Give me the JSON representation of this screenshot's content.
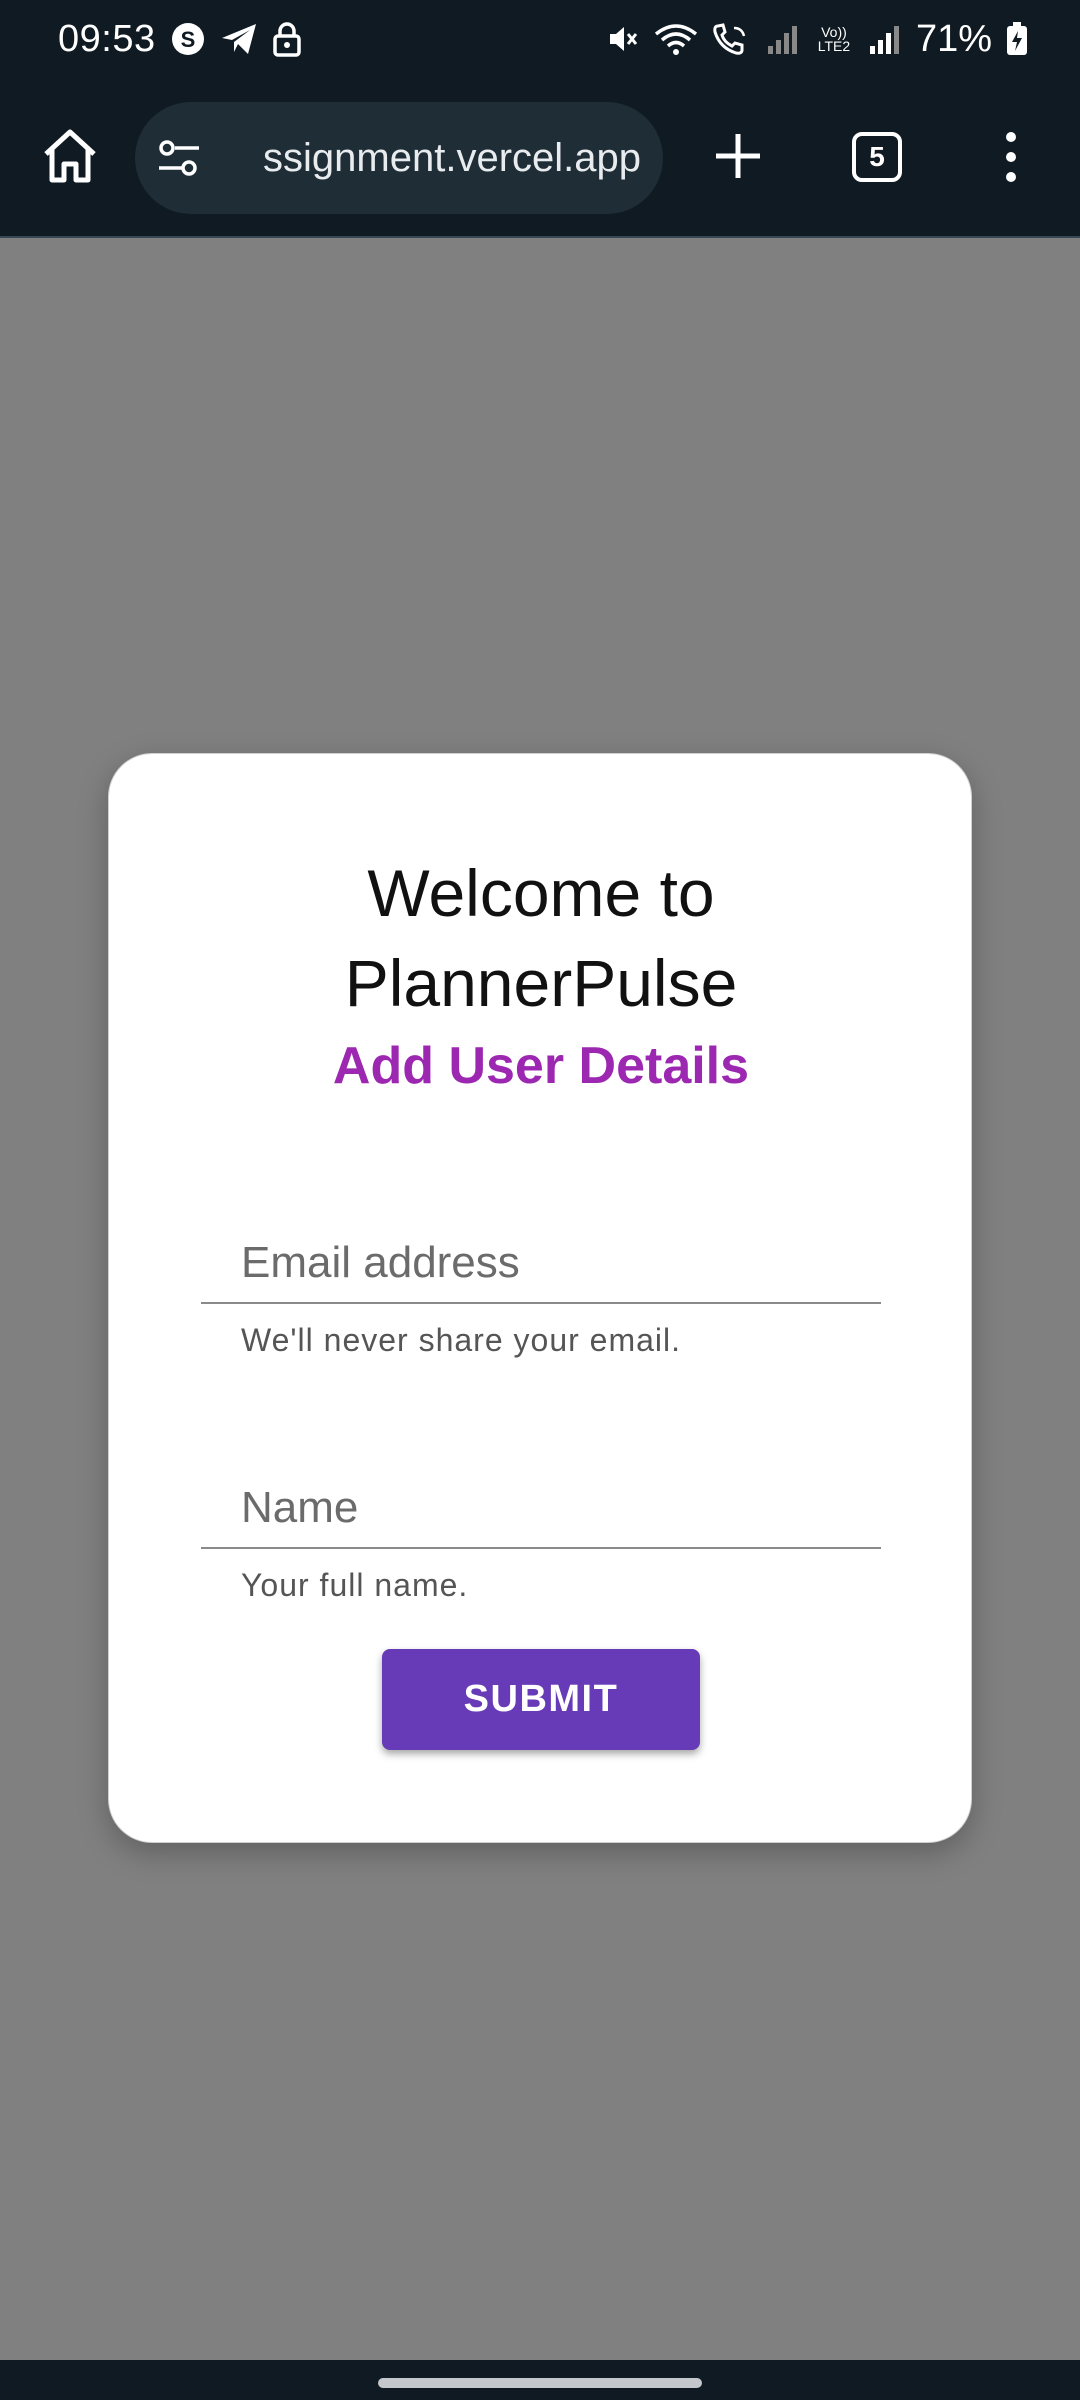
{
  "status_bar": {
    "time": "09:53",
    "battery": "71%",
    "left_icons": [
      "s-app-icon",
      "telegram-icon",
      "lock-icon"
    ],
    "right_icons": [
      "mute-icon",
      "wifi-icon",
      "wifi-call-icon",
      "signal-icon",
      "volte-icon",
      "signal-icon",
      "battery-charging-icon"
    ],
    "network_label": "Vo)) LTE2"
  },
  "browser": {
    "url": "ssignment.vercel.app",
    "tab_count": "5"
  },
  "card": {
    "title": "Welcome to PlannerPulse",
    "subtitle": "Add User Details",
    "email": {
      "placeholder": "Email address",
      "value": "",
      "helper": "We'll never share your email."
    },
    "name": {
      "placeholder": "Name",
      "value": "",
      "helper": "Your full name."
    },
    "submit_label": "SUBMIT"
  },
  "colors": {
    "subtitle": "#9c27b0",
    "submit_button": "#673ab7",
    "backdrop": "#808080",
    "chrome": "#0f1a22"
  }
}
